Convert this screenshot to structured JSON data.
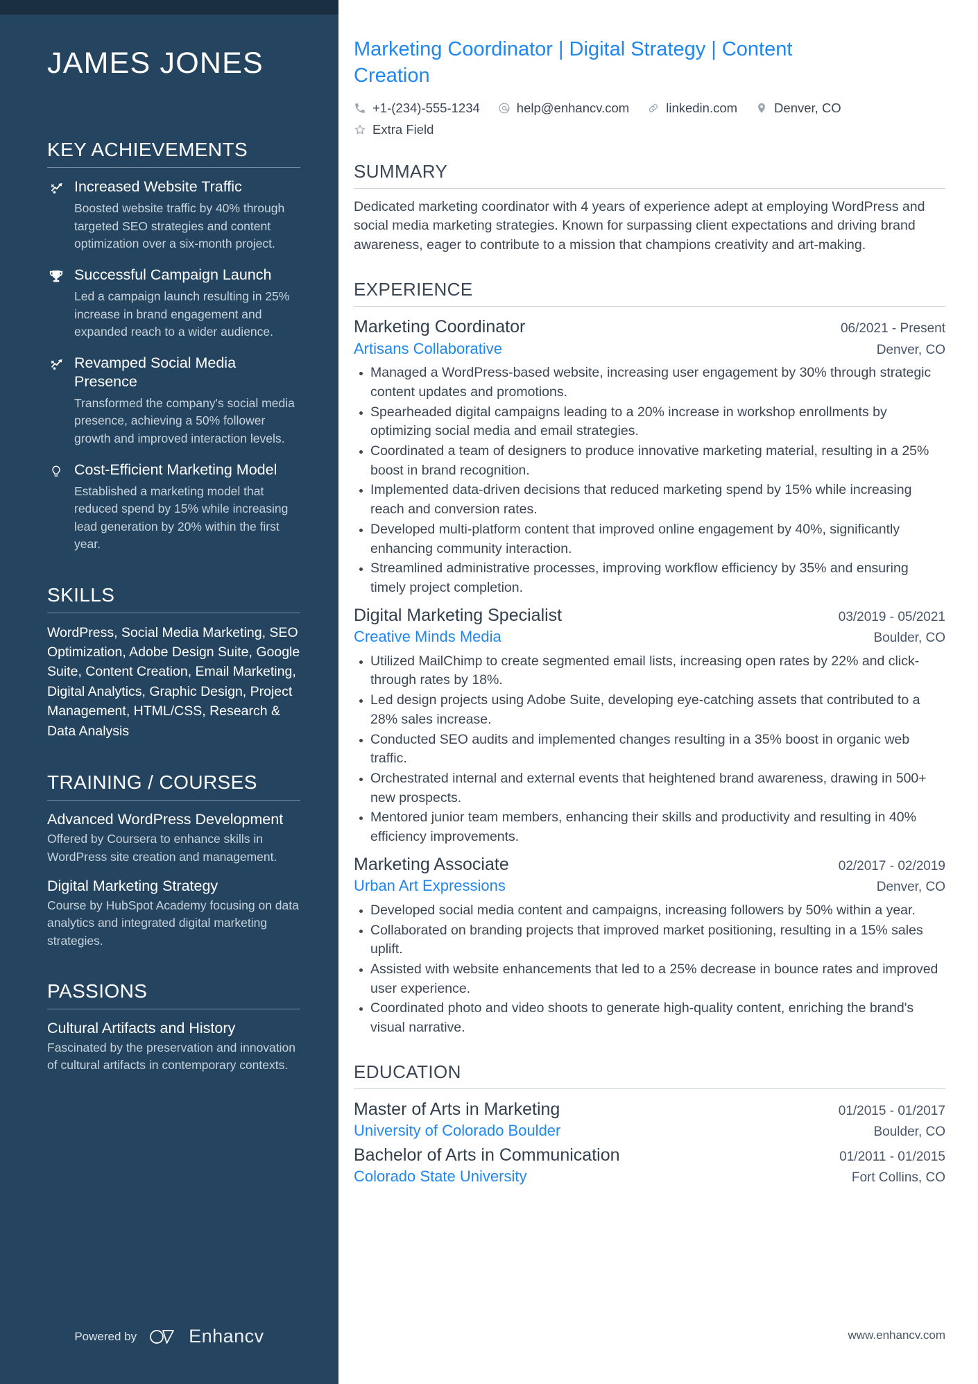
{
  "sidebar": {
    "name": "JAMES JONES",
    "achievements_heading": "KEY ACHIEVEMENTS",
    "achievements": [
      {
        "icon": "trending-up-icon",
        "title": "Increased Website Traffic",
        "desc": "Boosted website traffic by 40% through targeted SEO strategies and content optimization over a six-month project."
      },
      {
        "icon": "trophy-icon",
        "title": "Successful Campaign Launch",
        "desc": "Led a campaign launch resulting in 25% increase in brand engagement and expanded reach to a wider audience."
      },
      {
        "icon": "trending-up-icon",
        "title": "Revamped Social Media Presence",
        "desc": "Transformed the company's social media presence, achieving a 50% follower growth and improved interaction levels."
      },
      {
        "icon": "lightbulb-icon",
        "title": "Cost-Efficient Marketing Model",
        "desc": "Established a marketing model that reduced spend by 15% while increasing lead generation by 20% within the first year."
      }
    ],
    "skills_heading": "SKILLS",
    "skills_text": "WordPress, Social Media Marketing, SEO Optimization, Adobe Design Suite, Google Suite, Content Creation, Email Marketing, Digital Analytics, Graphic Design, Project Management, HTML/CSS, Research & Data Analysis",
    "training_heading": "TRAINING / COURSES",
    "courses": [
      {
        "title": "Advanced WordPress Development",
        "desc": "Offered by Coursera to enhance skills in WordPress site creation and management."
      },
      {
        "title": "Digital Marketing Strategy",
        "desc": "Course by HubSpot Academy focusing on data analytics and integrated digital marketing strategies."
      }
    ],
    "passions_heading": "PASSIONS",
    "passions": [
      {
        "title": "Cultural Artifacts and History",
        "desc": "Fascinated by the preservation and innovation of cultural artifacts in contemporary contexts."
      }
    ],
    "powered_by": "Powered by",
    "brand": "Enhancv"
  },
  "header": {
    "headline": "Marketing Coordinator | Digital Strategy | Content Creation",
    "contacts": [
      {
        "icon": "phone-icon",
        "value": "+1-(234)-555-1234"
      },
      {
        "icon": "email-icon",
        "value": "help@enhancv.com"
      },
      {
        "icon": "link-icon",
        "value": "linkedin.com"
      },
      {
        "icon": "location-pin-icon",
        "value": "Denver, CO"
      },
      {
        "icon": "star-icon",
        "value": "Extra Field"
      }
    ]
  },
  "summary": {
    "heading": "SUMMARY",
    "text": "Dedicated marketing coordinator with 4 years of experience adept at employing WordPress and social media marketing strategies. Known for surpassing client expectations and driving brand awareness, eager to contribute to a mission that champions creativity and art-making."
  },
  "experience": {
    "heading": "EXPERIENCE",
    "entries": [
      {
        "title": "Marketing Coordinator",
        "date": "06/2021 - Present",
        "org": "Artisans Collaborative",
        "location": "Denver, CO",
        "bullets": [
          "Managed a WordPress-based website, increasing user engagement by 30% through strategic content updates and promotions.",
          "Spearheaded digital campaigns leading to a 20% increase in workshop enrollments by optimizing social media and email strategies.",
          "Coordinated a team of designers to produce innovative marketing material, resulting in a 25% boost in brand recognition.",
          "Implemented data-driven decisions that reduced marketing spend by 15% while increasing reach and conversion rates.",
          "Developed multi-platform content that improved online engagement by 40%, significantly enhancing community interaction.",
          "Streamlined administrative processes, improving workflow efficiency by 35% and ensuring timely project completion."
        ]
      },
      {
        "title": "Digital Marketing Specialist",
        "date": "03/2019 - 05/2021",
        "org": "Creative Minds Media",
        "location": "Boulder, CO",
        "bullets": [
          "Utilized MailChimp to create segmented email lists, increasing open rates by 22% and click-through rates by 18%.",
          "Led design projects using Adobe Suite, developing eye-catching assets that contributed to a 28% sales increase.",
          "Conducted SEO audits and implemented changes resulting in a 35% boost in organic web traffic.",
          "Orchestrated internal and external events that heightened brand awareness, drawing in 500+ new prospects.",
          "Mentored junior team members, enhancing their skills and productivity and resulting in 40% efficiency improvements."
        ]
      },
      {
        "title": "Marketing Associate",
        "date": "02/2017 - 02/2019",
        "org": "Urban Art Expressions",
        "location": "Denver, CO",
        "bullets": [
          "Developed social media content and campaigns, increasing followers by 50% within a year.",
          "Collaborated on branding projects that improved market positioning, resulting in a 15% sales uplift.",
          "Assisted with website enhancements that led to a 25% decrease in bounce rates and improved user experience.",
          "Coordinated photo and video shoots to generate high-quality content, enriching the brand's visual narrative."
        ]
      }
    ]
  },
  "education": {
    "heading": "EDUCATION",
    "entries": [
      {
        "title": "Master of Arts in Marketing",
        "date": "01/2015 - 01/2017",
        "org": "University of Colorado Boulder",
        "location": "Boulder, CO"
      },
      {
        "title": "Bachelor of Arts in Communication",
        "date": "01/2011 - 01/2015",
        "org": "Colorado State University",
        "location": "Fort Collins, CO"
      }
    ]
  },
  "footer": {
    "website": "www.enhancv.com"
  },
  "colors": {
    "sidebar_bg": "#24445f",
    "sidebar_topbar": "#1b2f42",
    "accent_blue": "#1f87f0",
    "body_text": "#3b4754"
  }
}
